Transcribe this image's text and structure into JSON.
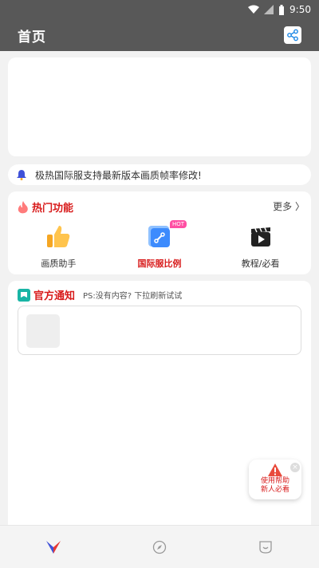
{
  "status_bar": {
    "time": "9:50"
  },
  "app_bar": {
    "title": "首页",
    "share_icon": "share-icon"
  },
  "notice": {
    "text": "极热国际服支持最新版本画质帧率修改!"
  },
  "hot": {
    "title": "热门功能",
    "more": "更多 〉",
    "features": [
      {
        "label": "画质助手",
        "icon": "thumbs-up-icon"
      },
      {
        "label": "国际服比例",
        "icon": "document-icon",
        "badge": "HOT"
      },
      {
        "label": "教程/必看",
        "icon": "video-icon"
      }
    ]
  },
  "official": {
    "title": "官方通知",
    "subtitle": "PS:没有内容? 下拉刷新试试"
  },
  "help": {
    "line1": "使用帮助",
    "line2": "新人必看"
  },
  "colors": {
    "accent": "#d81b1b",
    "header": "#585858",
    "hot_badge": "#ff4fa3"
  }
}
